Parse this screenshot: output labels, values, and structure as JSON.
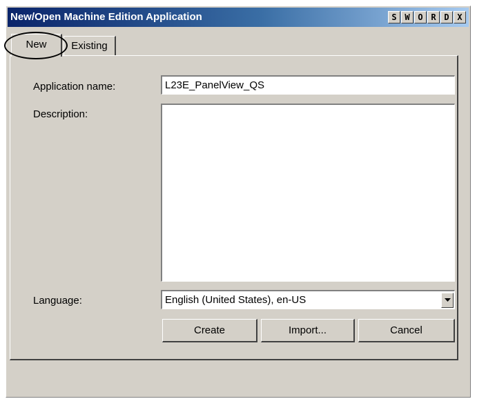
{
  "window": {
    "title": "New/Open Machine Edition Application",
    "title_buttons": [
      "S",
      "W",
      "O",
      "R",
      "D",
      "X"
    ]
  },
  "tabs": [
    {
      "label": "New",
      "selected": true
    },
    {
      "label": "Existing",
      "selected": false
    }
  ],
  "form": {
    "app_name_label": "Application name:",
    "app_name_value": "L23E_PanelView_QS",
    "description_label": "Description:",
    "description_value": "",
    "language_label": "Language:",
    "language_value": "English (United States), en-US"
  },
  "buttons": {
    "create": "Create",
    "import": "Import...",
    "cancel": "Cancel"
  },
  "icons": {
    "dropdown": "chevron-down-icon"
  }
}
